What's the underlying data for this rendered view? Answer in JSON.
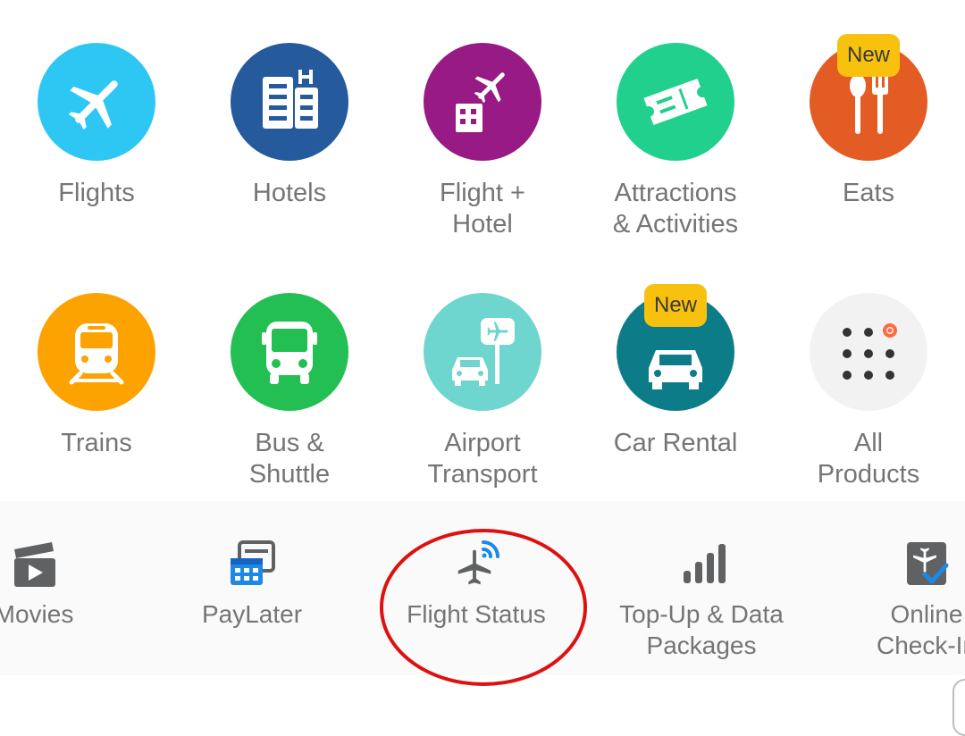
{
  "products": [
    {
      "label": "Flights",
      "badge": "",
      "color": "#2ec7f4"
    },
    {
      "label": "Hotels",
      "badge": "",
      "color": "#255a9c"
    },
    {
      "label": "Flight +\nHotel",
      "badge": "",
      "color": "#971a85"
    },
    {
      "label": "Attractions\n& Activities",
      "badge": "",
      "color": "#21d08c"
    },
    {
      "label": "Eats",
      "badge": "New",
      "color": "#e25c24"
    },
    {
      "label": "Trains",
      "badge": "",
      "color": "#fca301"
    },
    {
      "label": "Bus &\nShuttle",
      "badge": "",
      "color": "#23bf53"
    },
    {
      "label": "Airport\nTransport",
      "badge": "",
      "color": "#6fd5cf"
    },
    {
      "label": "Car Rental",
      "badge": "New",
      "color": "#0c7c88"
    },
    {
      "label": "All\nProducts",
      "badge": "",
      "color": "#f2f2f2"
    }
  ],
  "services": [
    {
      "label": "Movies",
      "icon": "movie-clapper-icon"
    },
    {
      "label": "PayLater",
      "icon": "paylater-calendar-icon"
    },
    {
      "label": "Flight Status",
      "icon": "flight-status-icon"
    },
    {
      "label": "Top-Up & Data\nPackages",
      "icon": "signal-bars-icon"
    },
    {
      "label": "Online\nCheck-In",
      "icon": "online-checkin-icon"
    }
  ],
  "colors": {
    "label_gray": "#757575",
    "badge_yellow": "#f8c10e",
    "annotation_red": "#dd1111",
    "icon_gray": "#5f6163",
    "paylater_blue": "#1e88e5"
  }
}
